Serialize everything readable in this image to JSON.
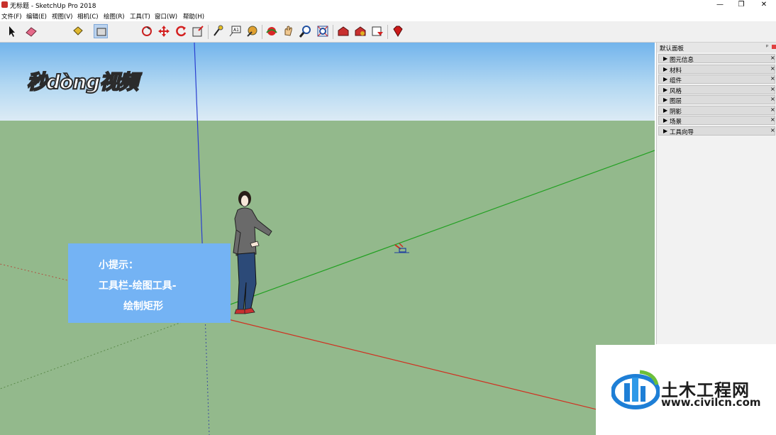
{
  "window": {
    "title": "无标题 - SketchUp Pro 2018",
    "minimize": "—",
    "restore": "❐",
    "close": "✕"
  },
  "menu": {
    "file": "文件(F)",
    "edit": "编辑(E)",
    "view": "视图(V)",
    "camera": "相机(C)",
    "draw": "绘图(R)",
    "tools": "工具(T)",
    "window": "窗口(W)",
    "help": "帮助(H)"
  },
  "toolbar": {
    "active_tool": "rectangle-tool",
    "icons": [
      "select-icon",
      "eraser-icon",
      "paint-bucket-icon",
      "rectangle-icon",
      "push-pull-icon",
      "follow-me-icon",
      "move-icon",
      "rotate-icon",
      "scale-icon",
      "tape-measure-icon",
      "text-icon",
      "paint-icon",
      "orbit-icon",
      "pan-icon",
      "zoom-icon",
      "zoom-extents-icon",
      "warehouse-icon",
      "extension-warehouse-icon",
      "layout-icon",
      "ruby-icon"
    ]
  },
  "watermark": {
    "text": "秒dòng视频"
  },
  "hint": {
    "line1": "小提示：",
    "line2": "工具栏-绘图工具-",
    "line3": "绘制矩形"
  },
  "tray": {
    "title": "默认面板",
    "pin": "ᵖ",
    "items": [
      {
        "label": "图元信息"
      },
      {
        "label": "材料"
      },
      {
        "label": "组件"
      },
      {
        "label": "风格"
      },
      {
        "label": "图层"
      },
      {
        "label": "阴影"
      },
      {
        "label": "场景"
      },
      {
        "label": "工具向导"
      }
    ],
    "close_glyph": "×",
    "expand_glyph": "▶"
  },
  "logo": {
    "main": "土木工程网",
    "url": "www.civilcn.com"
  },
  "colors": {
    "sky_top": "#72b4ec",
    "ground": "#93b98c",
    "hint_bg": "#74b3f4",
    "axis_red": "#d03020",
    "axis_green": "#22a022",
    "axis_blue": "#2a3fd0"
  }
}
